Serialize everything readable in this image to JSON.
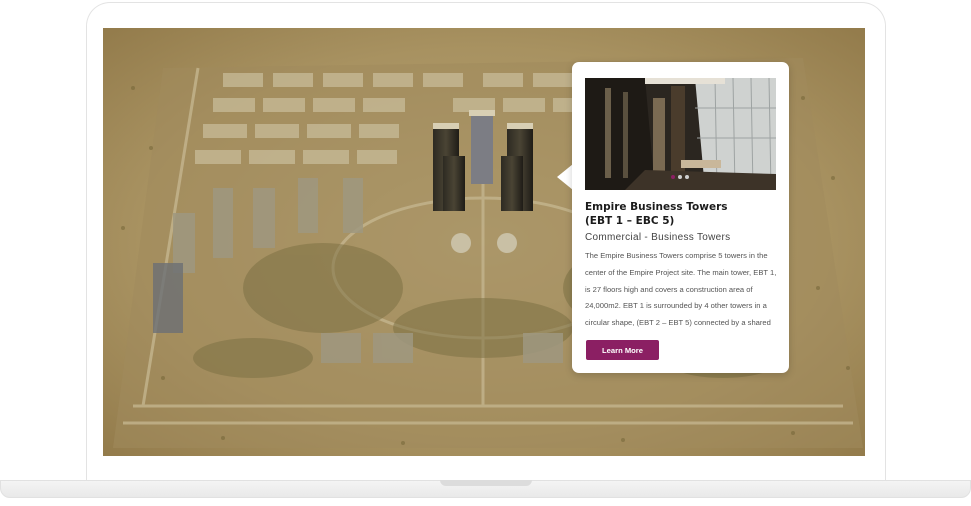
{
  "popup": {
    "title": "Empire Business Towers\n(EBT 1 – EBC 5)",
    "subtitle": "Commercial - Business Towers",
    "description": "The Empire Business Towers comprise 5 towers in the center of the Empire Project site. The main tower, EBT 1, is 27 floors high and covers a construction area of 24,000m2. EBT 1 is surrounded by 4 other towers in a circular shape, (EBT 2 – EBT 5) connected by a shared podium.",
    "button_label": "Learn More",
    "slider": {
      "count": 3,
      "active_index": 0
    }
  },
  "colors": {
    "accent": "#8b1f63",
    "map_sand": "#a8915c",
    "popup_bg": "#ffffff"
  }
}
